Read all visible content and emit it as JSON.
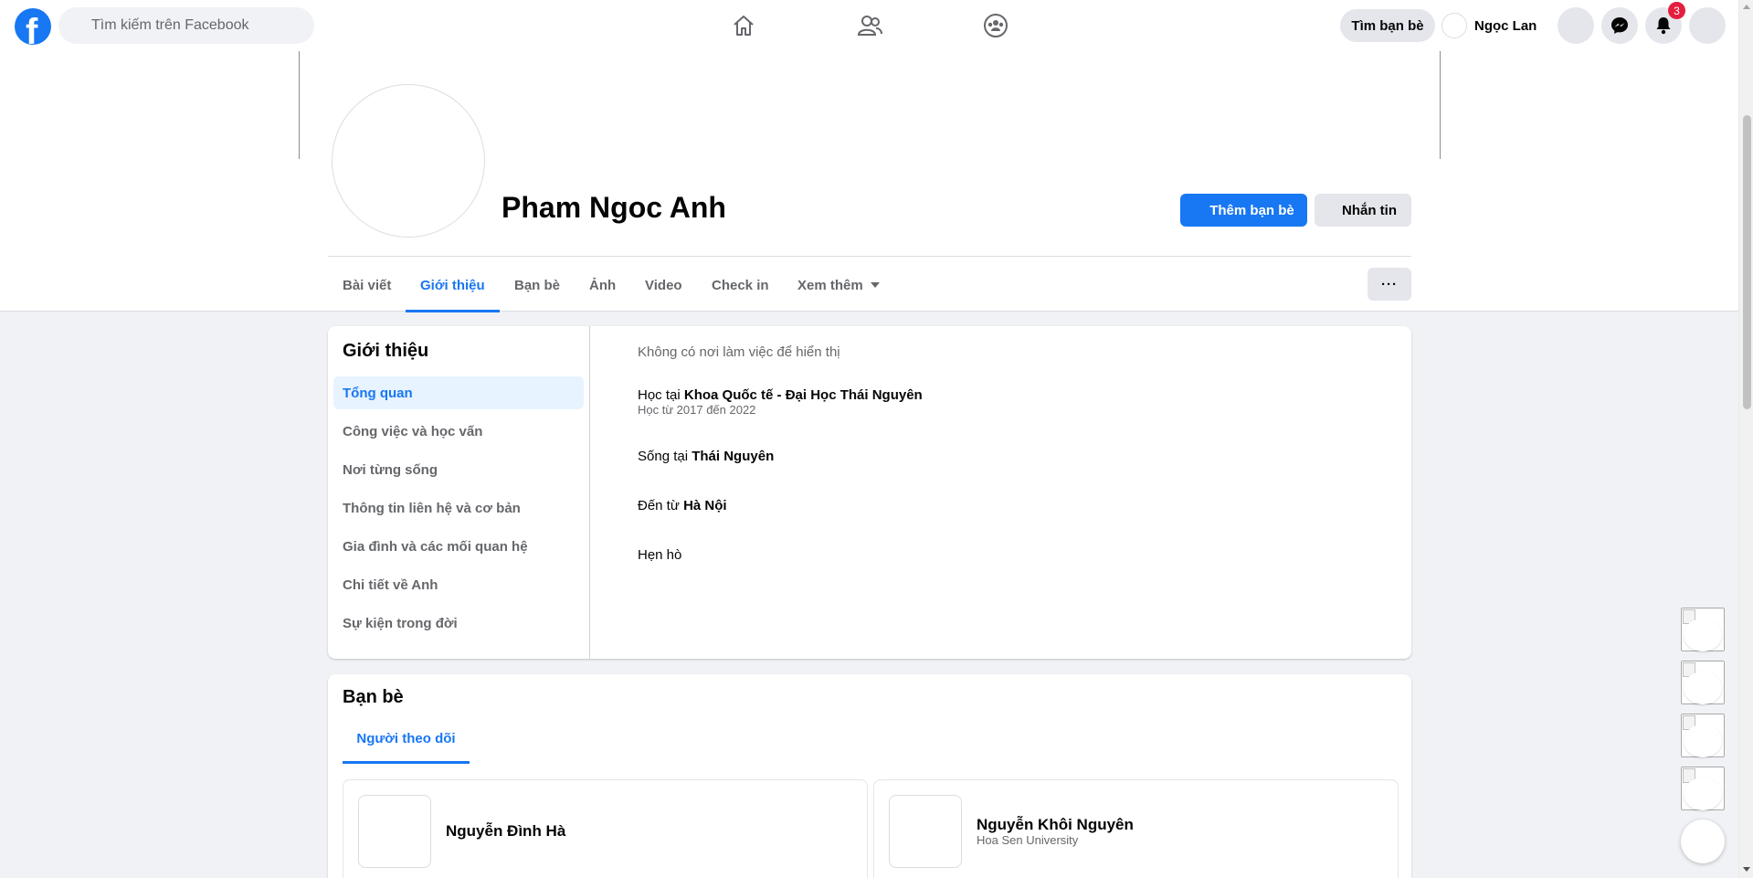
{
  "topbar": {
    "logo": "facebook-f",
    "search_placeholder": "Tìm kiếm trên Facebook",
    "nav_icons": [
      "home-icon",
      "friends-icon",
      "groups-icon"
    ],
    "find_friends_label": "Tìm bạn bè",
    "user_name": "Ngọc Lan",
    "notification_count": "3"
  },
  "profile": {
    "name": "Pham Ngoc Anh",
    "add_friend_label": "Thêm bạn bè",
    "message_label": "Nhắn tin",
    "more_label": "···"
  },
  "tabs": [
    {
      "label": "Bài viết",
      "active": false
    },
    {
      "label": "Giới thiệu",
      "active": true
    },
    {
      "label": "Bạn bè",
      "active": false
    },
    {
      "label": "Ảnh",
      "active": false
    },
    {
      "label": "Video",
      "active": false
    },
    {
      "label": "Check in",
      "active": false
    },
    {
      "label": "Xem thêm",
      "active": false
    }
  ],
  "about": {
    "title": "Giới thiệu",
    "menu": [
      "Tổng quan",
      "Công việc và học vấn",
      "Nơi từng sống",
      "Thông tin liên hệ và cơ bản",
      "Gia đình và các mối quan hệ",
      "Chi tiết về Anh",
      "Sự kiện trong đời"
    ],
    "work_empty": "Không có nơi làm việc để hiển thị",
    "study_prefix": "Học tại",
    "study_place": "Khoa Quốc tế - Đại Học Thái Nguyên",
    "study_years": "Học từ 2017 đến 2022",
    "lives_prefix": "Sống tại",
    "lives_place": "Thái Nguyên",
    "from_prefix": "Đến từ",
    "from_place": "Hà Nội",
    "relationship": "Hẹn hò"
  },
  "friends": {
    "title": "Bạn bè",
    "tab_label": "Người theo dõi",
    "items": [
      {
        "name": "Nguyễn Đình Hà",
        "sub": ""
      },
      {
        "name": "Nguyễn Khôi Nguyên",
        "sub": "Hoa Sen University"
      }
    ]
  },
  "colors": {
    "accent": "#1877f2",
    "badge": "#e41e3f",
    "background": "#f0f2f5"
  }
}
